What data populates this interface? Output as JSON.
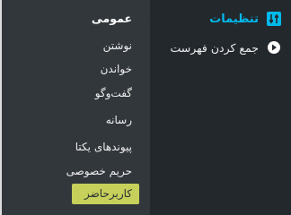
{
  "main_menu": {
    "active_item": {
      "label": "تنظیمات",
      "icon": "settings-sliders-icon"
    },
    "next_item": {
      "label": "جمع کردن فهرست",
      "icon": "collapse-menu-icon"
    }
  },
  "submenu": {
    "items": [
      {
        "label": "عمومی",
        "state": "current"
      },
      {
        "label": "نوشتن",
        "state": "normal"
      },
      {
        "label": "خواندن",
        "state": "normal"
      },
      {
        "label": "گفت‌وگو",
        "state": "normal"
      },
      {
        "label": "رسانه",
        "state": "normal"
      },
      {
        "label": "پیوندهای یکتا",
        "state": "normal"
      },
      {
        "label": "حریم خصوصی",
        "state": "normal"
      },
      {
        "label": "کاربرحاضر",
        "state": "highlighted"
      }
    ]
  },
  "colors": {
    "menu_background": "#23282d",
    "submenu_background": "#32373c",
    "active_text": "#00b9eb",
    "highlight": "#e7f160"
  }
}
